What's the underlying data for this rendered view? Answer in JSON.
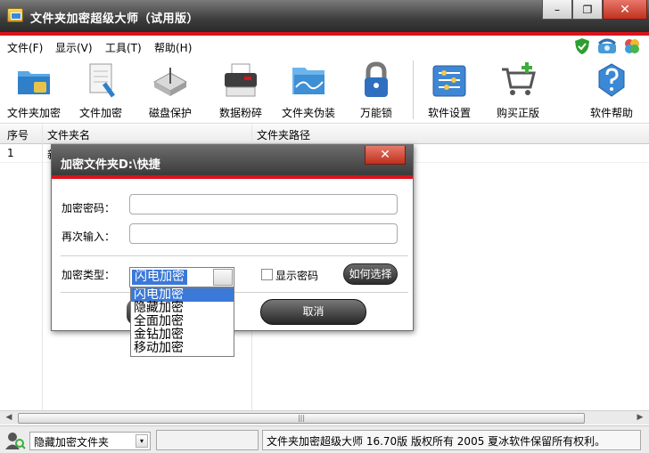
{
  "window": {
    "title": "文件夹加密超级大师（试用版）",
    "minimize_glyph": "–",
    "restore_glyph": "❐",
    "close_glyph": "✕"
  },
  "menu": [
    "文件(F)",
    "显示(V)",
    "工具(T)",
    "帮助(H)"
  ],
  "menu_icons": [
    "shield-check-icon",
    "phone-icon",
    "clover-icon"
  ],
  "toolbar": [
    {
      "label": "文件夹加密",
      "icon": "folder-lock-icon"
    },
    {
      "label": "文件加密",
      "icon": "file-lock-icon"
    },
    {
      "label": "磁盘保护",
      "icon": "disk-usb-icon"
    },
    {
      "label": "数据粉碎",
      "icon": "shredder-icon"
    },
    {
      "label": "文件夹伪装",
      "icon": "folder-disguise-icon"
    },
    {
      "label": "万能锁",
      "icon": "padlock-icon"
    },
    {
      "label": "软件设置",
      "icon": "settings-icon"
    },
    {
      "label": "购买正版",
      "icon": "cart-icon"
    },
    {
      "label": "软件帮助",
      "icon": "help-icon"
    }
  ],
  "table": {
    "columns": [
      "序号",
      "文件夹名",
      "文件夹路径"
    ],
    "rows": [
      {
        "index": "1",
        "name": "新",
        "path": ""
      }
    ]
  },
  "status": {
    "select_value": "隐藏加密文件夹",
    "copyright": "文件夹加密超级大师 16.70版 版权所有 2005 夏冰软件保留所有权利。"
  },
  "dialog": {
    "title": "加密文件夹D:\\快捷",
    "close_glyph": "✕",
    "password_label": "加密密码：",
    "confirm_label": "再次输入：",
    "type_label": "加密类型：",
    "type_value": "闪电加密",
    "show_password_label": "显示密码",
    "how_button": "如何选择",
    "cancel_button": "取消",
    "type_options": [
      "闪电加密",
      "隐藏加密",
      "全面加密",
      "金钻加密",
      "移动加密"
    ]
  },
  "colors": {
    "accent_red": "#d8141c",
    "selection_blue": "#3b79d8"
  }
}
